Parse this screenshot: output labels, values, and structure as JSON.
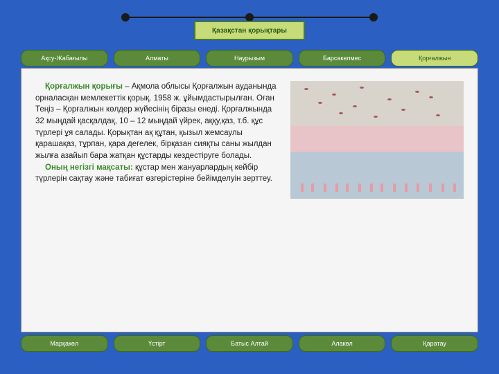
{
  "title": "Қазақстан қорықтары",
  "tabs_top": [
    {
      "label": "Ақсу-Жабағылы",
      "active": false
    },
    {
      "label": "Алматы",
      "active": false
    },
    {
      "label": "Наурызым",
      "active": false
    },
    {
      "label": "Барсакелмес",
      "active": false
    },
    {
      "label": "Қорғалжын",
      "active": true
    }
  ],
  "tabs_bottom": [
    {
      "label": "Марқакөл"
    },
    {
      "label": "Үстірт"
    },
    {
      "label": "Батыс Алтай"
    },
    {
      "label": "Алакөл"
    },
    {
      "label": "Қаратау"
    }
  ],
  "article": {
    "lead": "Қорғалжын қорығы",
    "body1": " – Ақмола облысы Қорғалжын ауданында орналасқан мемлекеттік қорық. 1958 ж. ұйымдастырылған. Оған Теңіз – Қорғалжын көлдер жүйесінің біразы енеді. Қорғалжында 32 мыңдай қасқалдақ, 10 – 12 мыңдай үйрек, аққу,қаз, т.б. құс түрлері ұя салады. Қорықтан ақ құтан, қызыл жемсаулы қарашақаз, тұрпан, қара дегелек, бірқазан сияқты саны жылдан жылға азайып бара жатқан құстарды кездестіруге болады.",
    "lead2": "Оның негізгі мақсаты:",
    "body2": " құстар мен жануарлардың кейбір түрлерін сақтау және табиғат өзгерістеріне бейімделуін зерттеу."
  },
  "image_alt": "flamingo-flock"
}
